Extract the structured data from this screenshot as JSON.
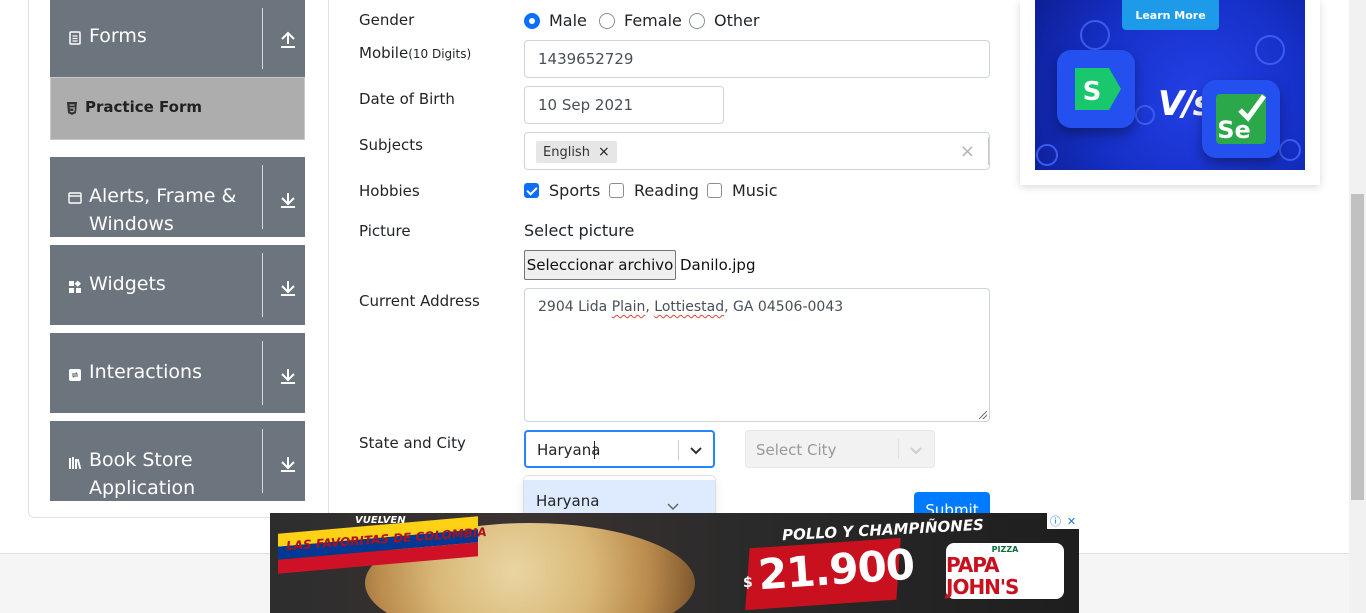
{
  "sidebar": {
    "groups": [
      {
        "label": "Forms",
        "icon": "document-icon",
        "arrow": "arrow-up-icon"
      },
      {
        "label_line1": "Alerts, Frame &",
        "label_line2": "Windows",
        "icon": "browser-window-icon",
        "arrow": "arrow-down-icon"
      },
      {
        "label": "Widgets",
        "icon": "widgets-icon",
        "arrow": "arrow-down-icon"
      },
      {
        "label": "Interactions",
        "icon": "interactions-icon",
        "arrow": "arrow-down-icon"
      },
      {
        "label_line1": "Book Store",
        "label_line2": "Application",
        "icon": "books-icon",
        "arrow": "arrow-down-icon"
      }
    ],
    "active_item": "Practice Form",
    "group_color": "#6c757d",
    "active_bg": "#adadad"
  },
  "form": {
    "gender_label": "Gender",
    "gender_options": [
      "Male",
      "Female",
      "Other"
    ],
    "gender_selected": "Male",
    "mobile_label": "Mobile",
    "mobile_hint": "(10 Digits)",
    "mobile_value": "1439652729",
    "dob_label": "Date of Birth",
    "dob_value": "10 Sep 2021",
    "subjects_label": "Subjects",
    "subject_chips": [
      "English"
    ],
    "chip_remove": "×",
    "clear_symbol": "×",
    "hobbies_label": "Hobbies",
    "hobbies": [
      {
        "label": "Sports",
        "checked": true
      },
      {
        "label": "Reading",
        "checked": false
      },
      {
        "label": "Music",
        "checked": false
      }
    ],
    "picture_label": "Picture",
    "picture_prompt": "Select picture",
    "file_button": "Seleccionar archivo",
    "file_name": "Danilo.jpg",
    "address_label": "Current Address",
    "address_parts": [
      "2904 Lida ",
      "Plain",
      ", ",
      "Lottiestad",
      ", GA 04506-0043"
    ],
    "state_city_label": "State and City",
    "state_value": "Haryana",
    "city_placeholder": "Select City",
    "state_dropdown_options": [
      "Haryana"
    ],
    "submit_label": "Submit",
    "accent": "#0d6efd"
  },
  "ad_top": {
    "cta": "Learn More",
    "vs_text": "V/s",
    "logo_left": "S",
    "logo_right": "Se"
  },
  "ad_bottom": {
    "tag": "VUELVEN",
    "headline": "LAS FAVORITAS DE COLOMBIA",
    "product": "POLLO Y CHAMPIÑONES",
    "currency": "$",
    "price": "21.900",
    "brand_small": "PIZZA",
    "brand": "PAPA JOHN'S",
    "info_symbol": "ⓘ",
    "close_symbol": "✕"
  }
}
